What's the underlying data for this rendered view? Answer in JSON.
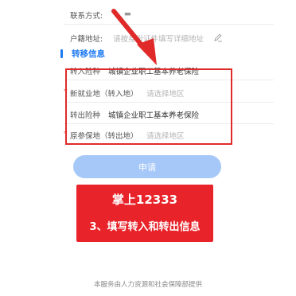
{
  "form": {
    "contact": {
      "label": "联系方式:",
      "value": "▬"
    },
    "address": {
      "label": "户籍地址:",
      "placeholder": "请按身份证件填写详细地址"
    },
    "transfer_section": {
      "title": "转移信息"
    },
    "rows": [
      {
        "label": "转入险种",
        "value": "城镇企业职工基本养老保险",
        "required": ""
      },
      {
        "label": "新就业地（转入地）",
        "value": "请选择地区",
        "required": "*"
      },
      {
        "label": "转出险种",
        "value": "城镇企业职工基本养老保险",
        "required": ""
      },
      {
        "label": "原参保地（转出地）",
        "value": "请选择地区",
        "required": "*"
      }
    ]
  },
  "apply_button": {
    "label": "申请"
  },
  "banner": {
    "title": "掌上12333",
    "subtitle": "3、填写转入和转出信息"
  },
  "footer": {
    "text": "本服务由人力资源和社会保障部提供"
  },
  "colors": {
    "accent": "#1e7bf2",
    "highlight": "#e02a2a",
    "banner": "#e8232a",
    "button": "#a6c8f8"
  },
  "icons": {
    "edit": "edit-icon",
    "annotation": "red-arrow-icon"
  }
}
